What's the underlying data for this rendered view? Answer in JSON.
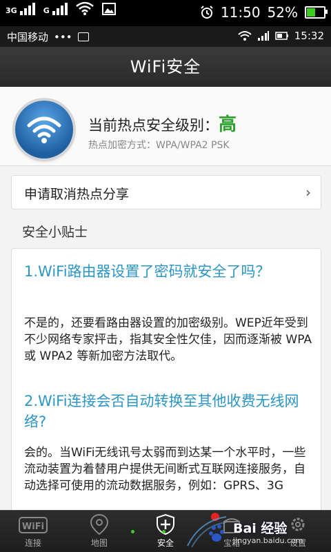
{
  "outer_status": {
    "network1": "3G",
    "network2": "G",
    "time": "11:50",
    "battery": "52%",
    "battery_fill": 0.52
  },
  "inner_status": {
    "carrier": "中国移动",
    "dots": "•••",
    "time": "15:32"
  },
  "titlebar": {
    "title": "WiFi安全"
  },
  "security": {
    "level_label": "当前热点安全级别：",
    "level_value": "高",
    "encryption": "热点加密方式：WPA/WPA2 PSK"
  },
  "request_row": {
    "label": "申请取消热点分享",
    "chevron": "›"
  },
  "tips_title": "安全小贴士",
  "tips": [
    {
      "question": "1.WiFi路由器设置了密码就安全了吗？",
      "answer": "不是的，还要看路由器设置的加密级别。WEP近年受到不少网络专家抨击，指其安全性欠佳，因而逐渐被 WPA或 WPA2 等新加密方法取代。"
    },
    {
      "question": "2.WiFi连接会否自动转换至其他收费无线网络?",
      "answer": "会的。当WiFi无线讯号太弱而到达某一个水平时，一些流动装置为着替用户提供无间断式互联网连接服务，自动选择可使用的流动数据服务，例如：GPRS、3G"
    }
  ],
  "bottom_nav": {
    "items": [
      {
        "label": "连接",
        "icon": "wifi-icon"
      },
      {
        "label": "地图",
        "icon": "map-pin-icon"
      },
      {
        "label": "安全",
        "icon": "shield-plus-icon"
      },
      {
        "label": "宝箱",
        "icon": "treasure-icon"
      },
      {
        "label": "设置",
        "icon": "gear-icon"
      }
    ]
  },
  "watermark": {
    "main": "Bai 经验",
    "sub": "jingyan.baidu.com"
  },
  "colors": {
    "accent": "#2b95c6",
    "level_green": "#2aa12a",
    "battery_green": "#3dcc1f"
  }
}
